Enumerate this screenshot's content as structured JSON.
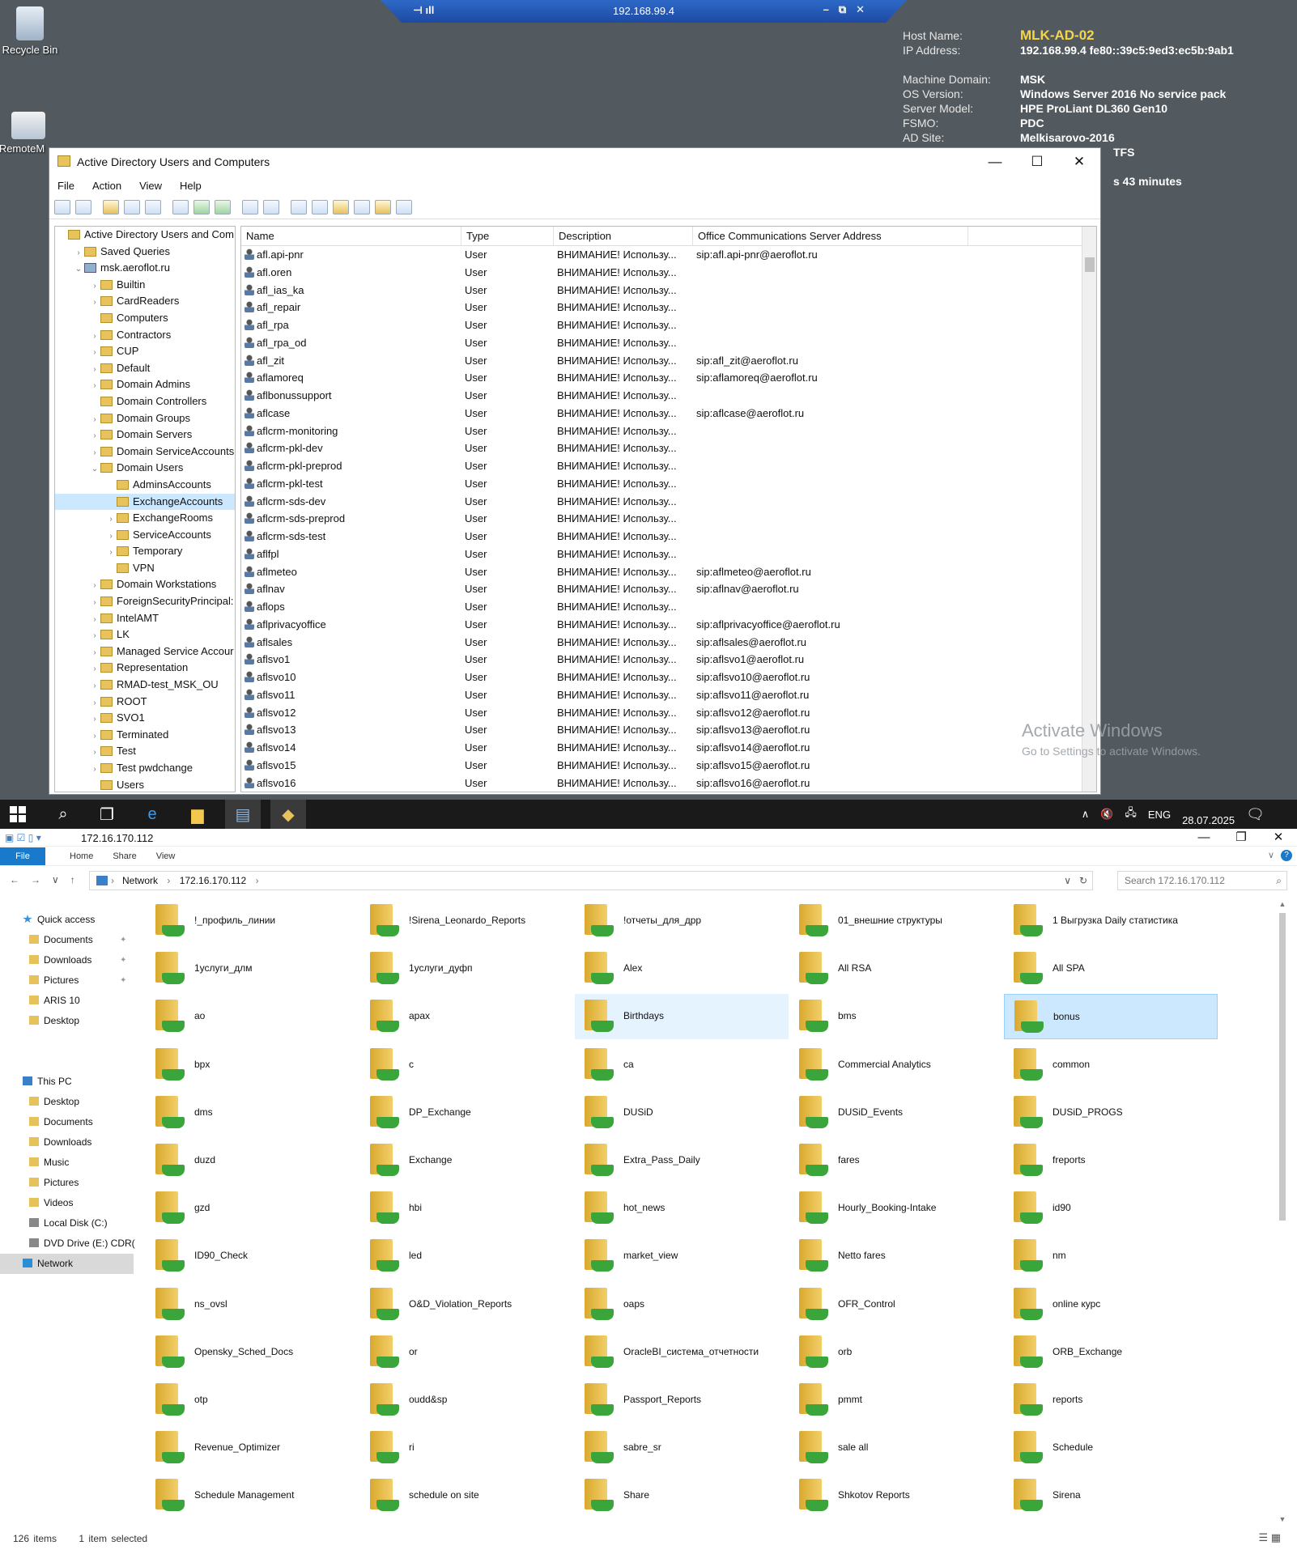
{
  "desktop": {
    "icons": [
      {
        "label": "Recycle Bin",
        "icon": "recycle-bin-icon"
      },
      {
        "label": "RemoteM",
        "icon": "remote-icon"
      }
    ]
  },
  "rdp": {
    "title": "192.168.99.4"
  },
  "bginfo": [
    {
      "k": "Host Name:",
      "v": "MLK-AD-02"
    },
    {
      "k": "IP Address:",
      "v": "192.168.99.4 fe80::39c5:9ed3:ec5b:9ab1"
    },
    {
      "k": "",
      "v": ""
    },
    {
      "k": "Machine Domain:",
      "v": "MSK"
    },
    {
      "k": "OS Version:",
      "v": "Windows Server 2016 No service pack"
    },
    {
      "k": "Server Model:",
      "v": "HPE ProLiant DL360 Gen10"
    },
    {
      "k": "FSMO:",
      "v": "PDC"
    },
    {
      "k": "AD Site:",
      "v": "Melkisarovo-2016"
    },
    {
      "k": "",
      "v": "TFS"
    },
    {
      "k": "",
      "v": ""
    },
    {
      "k": "",
      "v": "s 43 minutes"
    }
  ],
  "aduc": {
    "title": "Active Directory Users and Computers",
    "menu": [
      "File",
      "Action",
      "View",
      "Help"
    ],
    "tree": [
      {
        "label": "Active Directory Users and Com",
        "lvl": 0,
        "ch": "",
        "root": true
      },
      {
        "label": "Saved Queries",
        "lvl": 1,
        "ch": ">"
      },
      {
        "label": "msk.aeroflot.ru",
        "lvl": 1,
        "ch": "v",
        "dom": true
      },
      {
        "label": "Builtin",
        "lvl": 2,
        "ch": ">"
      },
      {
        "label": "CardReaders",
        "lvl": 2,
        "ch": ">"
      },
      {
        "label": "Computers",
        "lvl": 2,
        "ch": ""
      },
      {
        "label": "Contractors",
        "lvl": 2,
        "ch": ">"
      },
      {
        "label": "CUP",
        "lvl": 2,
        "ch": ">"
      },
      {
        "label": "Default",
        "lvl": 2,
        "ch": ">"
      },
      {
        "label": "Domain Admins",
        "lvl": 2,
        "ch": ">"
      },
      {
        "label": "Domain Controllers",
        "lvl": 2,
        "ch": ""
      },
      {
        "label": "Domain Groups",
        "lvl": 2,
        "ch": ">"
      },
      {
        "label": "Domain Servers",
        "lvl": 2,
        "ch": ">"
      },
      {
        "label": "Domain ServiceAccounts",
        "lvl": 2,
        "ch": ">"
      },
      {
        "label": "Domain Users",
        "lvl": 2,
        "ch": "v"
      },
      {
        "label": "AdminsAccounts",
        "lvl": 3,
        "ch": ""
      },
      {
        "label": "ExchangeAccounts",
        "lvl": 3,
        "ch": "",
        "sel": true
      },
      {
        "label": "ExchangeRooms",
        "lvl": 3,
        "ch": ">"
      },
      {
        "label": "ServiceAccounts",
        "lvl": 3,
        "ch": ">"
      },
      {
        "label": "Temporary",
        "lvl": 3,
        "ch": ">"
      },
      {
        "label": "VPN",
        "lvl": 3,
        "ch": ""
      },
      {
        "label": "Domain Workstations",
        "lvl": 2,
        "ch": ">"
      },
      {
        "label": "ForeignSecurityPrincipal:",
        "lvl": 2,
        "ch": ">"
      },
      {
        "label": "IntelAMT",
        "lvl": 2,
        "ch": ">"
      },
      {
        "label": "LK",
        "lvl": 2,
        "ch": ">"
      },
      {
        "label": "Managed Service Accour",
        "lvl": 2,
        "ch": ">"
      },
      {
        "label": "Representation",
        "lvl": 2,
        "ch": ">"
      },
      {
        "label": "RMAD-test_MSK_OU",
        "lvl": 2,
        "ch": ">"
      },
      {
        "label": "ROOT",
        "lvl": 2,
        "ch": ">"
      },
      {
        "label": "SVO1",
        "lvl": 2,
        "ch": ">"
      },
      {
        "label": "Terminated",
        "lvl": 2,
        "ch": ">"
      },
      {
        "label": "Test",
        "lvl": 2,
        "ch": ">"
      },
      {
        "label": "Test pwdchange",
        "lvl": 2,
        "ch": ">"
      },
      {
        "label": "Users",
        "lvl": 2,
        "ch": ""
      }
    ],
    "columns": [
      "Name",
      "Type",
      "Description",
      "Office Communications Server Address"
    ],
    "rows": [
      {
        "name": "afl.api-pnr",
        "type": "User",
        "desc": "ВНИМАНИЕ! Использу...",
        "sip": "sip:afl.api-pnr@aeroflot.ru"
      },
      {
        "name": "afl.oren",
        "type": "User",
        "desc": "ВНИМАНИЕ! Использу...",
        "sip": ""
      },
      {
        "name": "afl_ias_ka",
        "type": "User",
        "desc": "ВНИМАНИЕ! Использу...",
        "sip": ""
      },
      {
        "name": "afl_repair",
        "type": "User",
        "desc": "ВНИМАНИЕ! Использу...",
        "sip": ""
      },
      {
        "name": "afl_rpa",
        "type": "User",
        "desc": "ВНИМАНИЕ! Использу...",
        "sip": ""
      },
      {
        "name": "afl_rpa_od",
        "type": "User",
        "desc": "ВНИМАНИЕ! Использу...",
        "sip": ""
      },
      {
        "name": "afl_zit",
        "type": "User",
        "desc": "ВНИМАНИЕ! Использу...",
        "sip": "sip:afl_zit@aeroflot.ru"
      },
      {
        "name": "aflamoreq",
        "type": "User",
        "desc": "ВНИМАНИЕ! Использу...",
        "sip": "sip:aflamoreq@aeroflot.ru"
      },
      {
        "name": "aflbonussupport",
        "type": "User",
        "desc": "ВНИМАНИЕ! Использу...",
        "sip": ""
      },
      {
        "name": "aflcase",
        "type": "User",
        "desc": "ВНИМАНИЕ! Использу...",
        "sip": "sip:aflcase@aeroflot.ru"
      },
      {
        "name": "aflcrm-monitoring",
        "type": "User",
        "desc": "ВНИМАНИЕ! Использу...",
        "sip": ""
      },
      {
        "name": "aflcrm-pkl-dev",
        "type": "User",
        "desc": "ВНИМАНИЕ! Использу...",
        "sip": ""
      },
      {
        "name": "aflcrm-pkl-preprod",
        "type": "User",
        "desc": "ВНИМАНИЕ! Использу...",
        "sip": ""
      },
      {
        "name": "aflcrm-pkl-test",
        "type": "User",
        "desc": "ВНИМАНИЕ! Использу...",
        "sip": ""
      },
      {
        "name": "aflcrm-sds-dev",
        "type": "User",
        "desc": "ВНИМАНИЕ! Использу...",
        "sip": ""
      },
      {
        "name": "aflcrm-sds-preprod",
        "type": "User",
        "desc": "ВНИМАНИЕ! Использу...",
        "sip": ""
      },
      {
        "name": "aflcrm-sds-test",
        "type": "User",
        "desc": "ВНИМАНИЕ! Использу...",
        "sip": ""
      },
      {
        "name": "aflfpl",
        "type": "User",
        "desc": "ВНИМАНИЕ! Использу...",
        "sip": ""
      },
      {
        "name": "aflmeteo",
        "type": "User",
        "desc": "ВНИМАНИЕ! Использу...",
        "sip": "sip:aflmeteo@aeroflot.ru"
      },
      {
        "name": "aflnav",
        "type": "User",
        "desc": "ВНИМАНИЕ! Использу...",
        "sip": "sip:aflnav@aeroflot.ru"
      },
      {
        "name": "aflops",
        "type": "User",
        "desc": "ВНИМАНИЕ! Использу...",
        "sip": ""
      },
      {
        "name": "aflprivacyoffice",
        "type": "User",
        "desc": "ВНИМАНИЕ! Использу...",
        "sip": "sip:aflprivacyoffice@aeroflot.ru"
      },
      {
        "name": "aflsales",
        "type": "User",
        "desc": "ВНИМАНИЕ! Использу...",
        "sip": "sip:aflsales@aeroflot.ru"
      },
      {
        "name": "aflsvo1",
        "type": "User",
        "desc": "ВНИМАНИЕ! Использу...",
        "sip": "sip:aflsvo1@aeroflot.ru"
      },
      {
        "name": "aflsvo10",
        "type": "User",
        "desc": "ВНИМАНИЕ! Использу...",
        "sip": "sip:aflsvo10@aeroflot.ru"
      },
      {
        "name": "aflsvo11",
        "type": "User",
        "desc": "ВНИМАНИЕ! Использу...",
        "sip": "sip:aflsvo11@aeroflot.ru"
      },
      {
        "name": "aflsvo12",
        "type": "User",
        "desc": "ВНИМАНИЕ! Использу...",
        "sip": "sip:aflsvo12@aeroflot.ru"
      },
      {
        "name": "aflsvo13",
        "type": "User",
        "desc": "ВНИМАНИЕ! Использу...",
        "sip": "sip:aflsvo13@aeroflot.ru"
      },
      {
        "name": "aflsvo14",
        "type": "User",
        "desc": "ВНИМАНИЕ! Использу...",
        "sip": "sip:aflsvo14@aeroflot.ru"
      },
      {
        "name": "aflsvo15",
        "type": "User",
        "desc": "ВНИМАНИЕ! Использу...",
        "sip": "sip:aflsvo15@aeroflot.ru"
      },
      {
        "name": "aflsvo16",
        "type": "User",
        "desc": "ВНИМАНИЕ! Использу...",
        "sip": "sip:aflsvo16@aeroflot.ru"
      }
    ]
  },
  "watermark": {
    "line1": "Activate Windows",
    "line2": "Go to Settings to activate Windows."
  },
  "taskbar": {
    "lang": "ENG",
    "date": "28.07.2025"
  },
  "explorer": {
    "title": "172.16.170.112",
    "ribbon": [
      "File",
      "Home",
      "Share",
      "View"
    ],
    "path": [
      "Network",
      "172.16.170.112"
    ],
    "search_placeholder": "Search 172.16.170.112",
    "nav": [
      {
        "label": "Quick access",
        "icon": "star",
        "lvl": 0
      },
      {
        "label": "Documents",
        "icon": "doc",
        "lvl": 1,
        "pin": true
      },
      {
        "label": "Downloads",
        "icon": "doc",
        "lvl": 1,
        "pin": true
      },
      {
        "label": "Pictures",
        "icon": "doc",
        "lvl": 1,
        "pin": true
      },
      {
        "label": "ARIS 10",
        "icon": "doc",
        "lvl": 1
      },
      {
        "label": "Desktop",
        "icon": "doc",
        "lvl": 1
      },
      {
        "label": "",
        "icon": "",
        "lvl": 1
      },
      {
        "label": "",
        "icon": "",
        "lvl": 1
      },
      {
        "label": "This PC",
        "icon": "pc",
        "lvl": 0
      },
      {
        "label": "Desktop",
        "icon": "doc",
        "lvl": 1
      },
      {
        "label": "Documents",
        "icon": "doc",
        "lvl": 1
      },
      {
        "label": "Downloads",
        "icon": "doc",
        "lvl": 1
      },
      {
        "label": "Music",
        "icon": "doc",
        "lvl": 1
      },
      {
        "label": "Pictures",
        "icon": "doc",
        "lvl": 1
      },
      {
        "label": "Videos",
        "icon": "doc",
        "lvl": 1
      },
      {
        "label": "Local Disk (C:)",
        "icon": "disk",
        "lvl": 1
      },
      {
        "label": "DVD Drive (E:) CDR(",
        "icon": "disk",
        "lvl": 1
      },
      {
        "label": "Network",
        "icon": "net",
        "lvl": 0,
        "sel": true
      }
    ],
    "items": [
      "!_профиль_линии",
      "!Sirena_Leonardo_Reports",
      "!отчеты_для_дрр",
      "01_внешние структуры",
      "1 Выгрузка Daily статистика",
      "1услуги_длм",
      "1услуги_дуфп",
      "Alex",
      "All RSA",
      "All SPA",
      "ao",
      "apax",
      "Birthdays",
      "bms",
      "bonus",
      "bpx",
      "c",
      "ca",
      "Commercial Analytics",
      "common",
      "dms",
      "DP_Exchange",
      "DUSiD",
      "DUSiD_Events",
      "DUSiD_PROGS",
      "duzd",
      "Exchange",
      "Extra_Pass_Daily",
      "fares",
      "freports",
      "gzd",
      "hbi",
      "hot_news",
      "Hourly_Booking-Intake",
      "id90",
      "ID90_Check",
      "led",
      "market_view",
      "Netto fares",
      "nm",
      "ns_ovsl",
      "O&D_Violation_Reports",
      "oaps",
      "OFR_Control",
      "online курс",
      "Opensky_Sched_Docs",
      "or",
      "OracleBI_система_отчетности",
      "orb",
      "ORB_Exchange",
      "otp",
      "oudd&sp",
      "Passport_Reports",
      "pmmt",
      "reports",
      "Revenue_Optimizer",
      "ri",
      "sabre_sr",
      "sale all",
      "Schedule",
      "Schedule Management",
      "schedule on site",
      "Share",
      "Shkotov Reports",
      "Sirena"
    ],
    "status_count": "126 items",
    "status_sel": "1 item selected"
  }
}
